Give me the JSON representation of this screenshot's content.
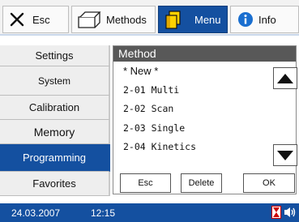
{
  "tabs": [
    {
      "label": "Esc",
      "icon": "close-x-icon"
    },
    {
      "label": "Methods",
      "icon": "folder-icon"
    },
    {
      "label": "Menu",
      "icon": "menu-folder-icon",
      "active": true
    },
    {
      "label": "Info",
      "icon": "info-icon"
    }
  ],
  "sidebar": {
    "items": [
      {
        "label": "Settings"
      },
      {
        "label": "System"
      },
      {
        "label": "Calibration"
      },
      {
        "label": "Memory"
      },
      {
        "label": "Programming",
        "active": true
      },
      {
        "label": "Favorites"
      }
    ]
  },
  "panel": {
    "title": "Method",
    "methods": [
      "* New *",
      "2-01 Multi",
      "2-02 Scan",
      "2-03 Single",
      "2-04 Kinetics"
    ]
  },
  "buttons": {
    "esc": "Esc",
    "delete": "Delete",
    "ok": "OK"
  },
  "status": {
    "date": "24.03.2007",
    "time": "12:15"
  },
  "colors": {
    "accent": "#1450a0",
    "panel_header": "#585858",
    "sidebar_bg": "#eeeeee"
  }
}
